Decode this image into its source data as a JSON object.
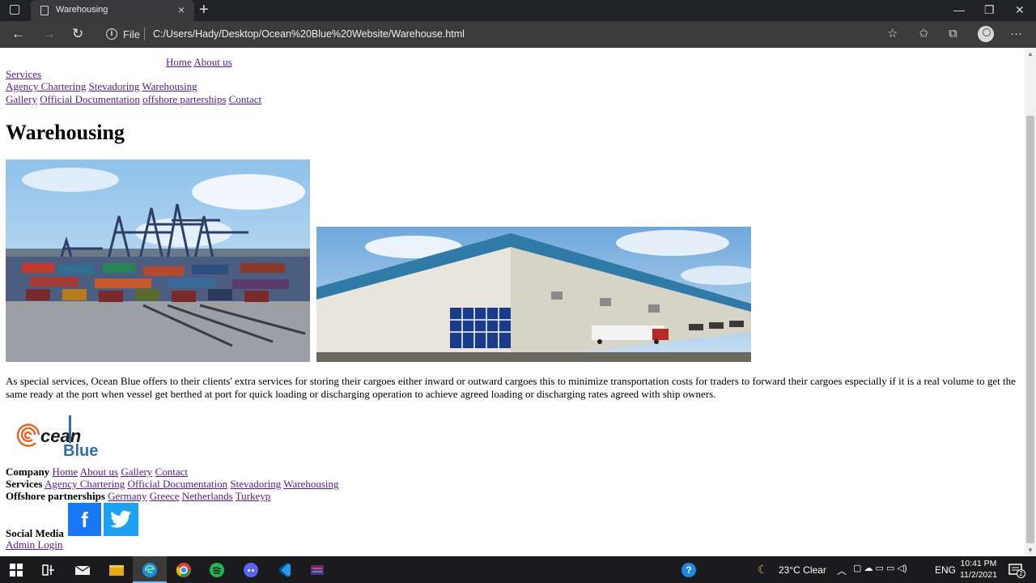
{
  "browser": {
    "tab_title": "Warehousing",
    "tab_close_icon": "close-icon",
    "new_tab_symbol": "+",
    "window_minimize": "—",
    "window_restore": "❐",
    "window_close": "✕",
    "back_symbol": "←",
    "forward_symbol": "→",
    "refresh_symbol": "↻",
    "info_symbol": "i",
    "file_label": "File",
    "url": "C:/Users/Hady/Desktop/Ocean%20Blue%20Website/Warehouse.html",
    "favorite_add_symbol": "☆",
    "favorites_symbol": "✩",
    "collections_symbol": "⧉",
    "more_symbol": "···"
  },
  "nav": {
    "home": "Home",
    "about": "About us",
    "services": "Services",
    "agency": "Agency Chartering",
    "stevadoring": "Stevadoring",
    "warehousing": "Warehousing",
    "gallery": "Gallery",
    "official_docs": "Official Documentation",
    "offshore": "offshore parterships",
    "contact": "Contact"
  },
  "main": {
    "title": "Warehousing",
    "description": "As special services, Ocean Blue offers to their clients' extra services for storing their cargoes either inward or outward cargoes this to minimize transportation costs for traders to forward their cargoes especially if it is a real volume to get the same ready at the port when vessel get berthed at port for quick loading or discharging operation to achieve agreed loading or discharging rates agreed with ship owners."
  },
  "logo": {
    "text_cean": "cean",
    "text_blue": "Blue"
  },
  "footer": {
    "company_label": "Company",
    "company_links": [
      "Home",
      "About us",
      "Gallery",
      "Contact"
    ],
    "services_label": "Services",
    "services_links": [
      "Agency Chartering",
      "Official Documentation",
      "Stevadoring",
      "Warehousing"
    ],
    "offshore_label": "Offshore partnerships",
    "offshore_links": [
      "Germany",
      "Greece",
      "Netherlands",
      "Turkeyp"
    ],
    "social_label": "Social Media",
    "facebook_glyph": "f",
    "admin_login": "Admin Login"
  },
  "taskbar": {
    "weather": "23°C  Clear",
    "lang": "ENG",
    "time": "10:41 PM",
    "date": "11/2/2021",
    "notification_count": "2"
  },
  "colors": {
    "link": "#551a8b",
    "facebook": "#1877f2",
    "twitter": "#1da1f2",
    "logo_orange": "#e0662a",
    "logo_blue": "#2e6fa8"
  }
}
